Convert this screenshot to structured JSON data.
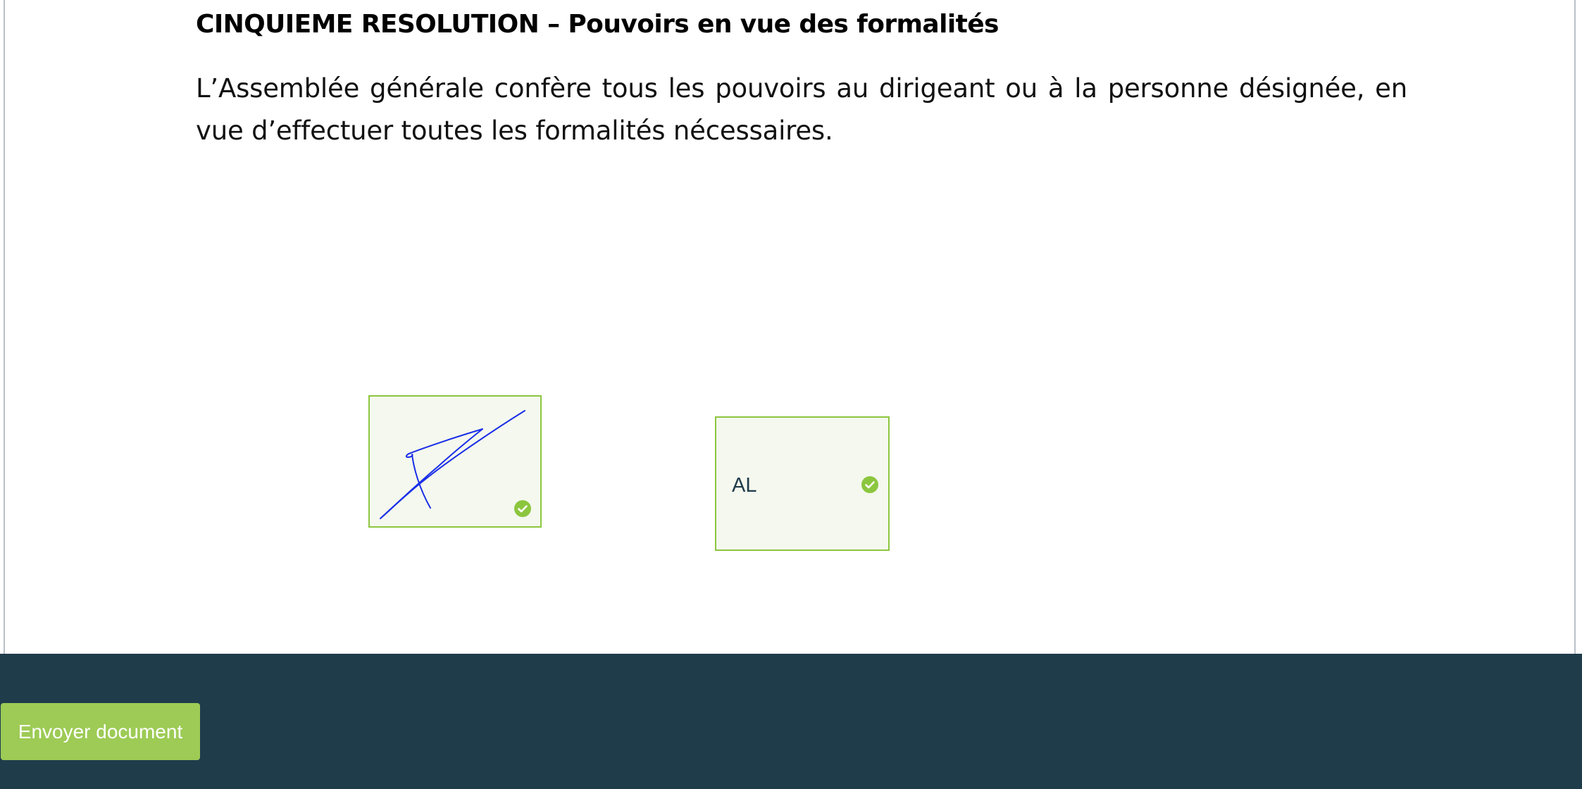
{
  "document": {
    "heading": "CINQUIEME RESOLUTION – Pouvoirs en vue des formalités",
    "paragraph": "L’Assemblée générale confère tous les pouvoirs au dirigeant ou à la personne désignée, en vue d’effectuer toutes les formalités nécessaires."
  },
  "signature_field": {
    "status_icon": "check-circle-icon",
    "completed": true
  },
  "initials_field": {
    "value": "AL",
    "status_icon": "check-circle-icon",
    "completed": true
  },
  "footer": {
    "send_button_label": "Envoyer document"
  },
  "colors": {
    "accent_green": "#8cc63f",
    "button_green": "#9dcb55",
    "footer_bg": "#1f3c4b",
    "field_bg": "#f4f8ee",
    "signature_ink": "#1a2ee8"
  }
}
